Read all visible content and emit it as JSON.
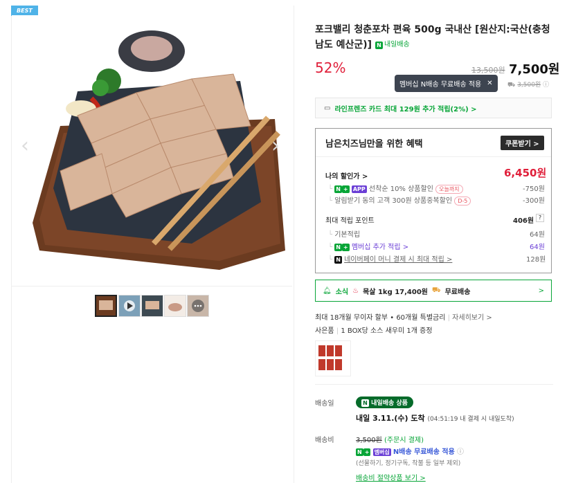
{
  "badge": "BEST",
  "thumbnails": [
    "thumb-1",
    "thumb-2",
    "thumb-3",
    "thumb-4",
    "more"
  ],
  "product": {
    "title": "포크밸리 청춘포차 편육 500g 국내산 [원산지:국산(충청남도 예산군)]",
    "delivery_badge": "내일배송",
    "discount": "52%",
    "original_price": "13,500원",
    "price": "7,500원",
    "tooltip": "멤버십 N배송 무료배송 적용",
    "shipping_strike": "3,500원"
  },
  "card_offer": "라인프렌즈 카드 최대 129원 추가 적립(2%) >",
  "benefit": {
    "title": "남은치즈님만을 위한 혜택",
    "coupon_button": "쿠폰받기 >",
    "my_discount_label": "나의 할인가 >",
    "my_discount_price": "6,450원",
    "items": [
      {
        "badges": [
          "N",
          "+",
          "APP"
        ],
        "text": "선착순 10% 상품할인",
        "pill": "오늘까지",
        "amount": "-750원"
      },
      {
        "badges": [],
        "text": "알림받기 동의 고객 300원 상품중복할인",
        "pill": "D-5",
        "amount": "-300원"
      }
    ],
    "points_label": "최대 적립 포인트",
    "points_total": "406원",
    "points_help": "?",
    "point_items": [
      {
        "text": "기본적립",
        "amount": "64원"
      },
      {
        "text": "멤버십 추가 적립 >",
        "amount": "64원"
      },
      {
        "text": "네이버페이 머니 결제 시 최대 적립 >",
        "amount": "128원"
      }
    ]
  },
  "news": {
    "prefix": "소식",
    "text": "목살 1kg 17,400원",
    "suffix": "무료배송",
    "arrow": ">"
  },
  "installment": {
    "text": "최대 18개월 무이자 할부 • 60개월 특별금리",
    "link": "자세히보기 >"
  },
  "gift": {
    "label": "사은품",
    "text": "1 BOX당 소스 새우미 1개 증정"
  },
  "shipping": {
    "date_label": "배송일",
    "badge": "내일배송 상품",
    "arrival": "내일 3.11.(수) 도착",
    "arrival_note": "(04:51:19 내 결제 시 내일도착)",
    "fee_label": "배송비",
    "fee": "3,500원",
    "fee_note": "(주문시 결제)",
    "membership_tag": "멤버십",
    "free_text": "N배송 무료배송 적용",
    "exclusions": "(선물하기, 정기구독, 착불 등 일부 제외)",
    "save_link": "배송비 절약상품 보기 >"
  }
}
